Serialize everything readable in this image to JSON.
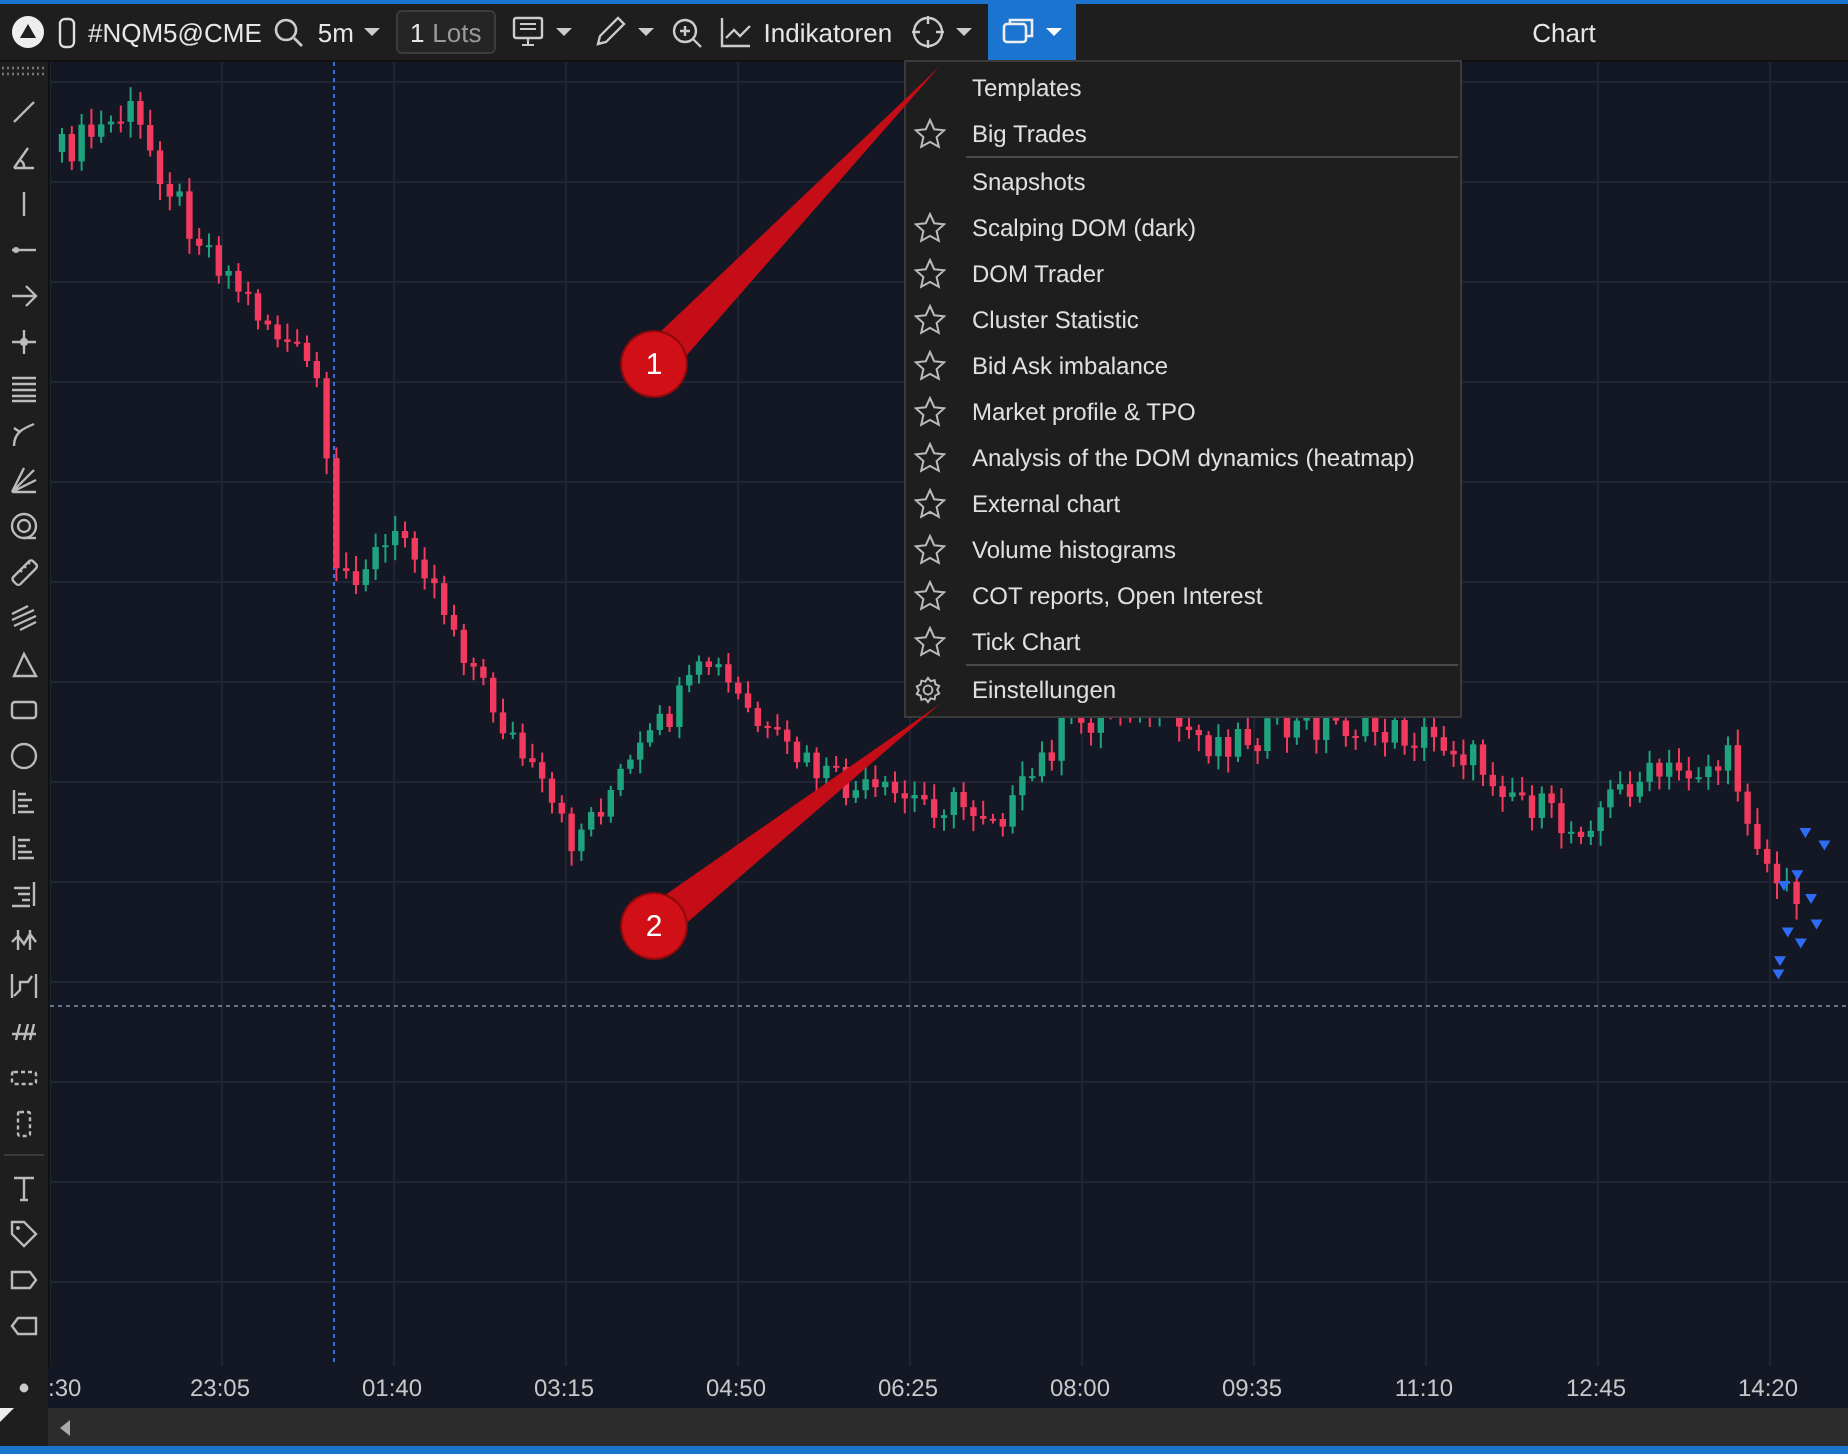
{
  "toolbar": {
    "symbol": "#NQM5@CME",
    "timeframe": "5m",
    "lots": {
      "value": "1",
      "unit": "Lots"
    },
    "indicators": "Indikatoren",
    "layouts_open": true
  },
  "window": {
    "title": "Chart"
  },
  "menu": {
    "items": [
      {
        "kind": "header",
        "label": "Templates"
      },
      {
        "kind": "favorite",
        "label": "Big Trades"
      },
      {
        "kind": "separator"
      },
      {
        "kind": "header",
        "label": "Snapshots"
      },
      {
        "kind": "favorite",
        "label": "Scalping DOM (dark)"
      },
      {
        "kind": "favorite",
        "label": "DOM Trader"
      },
      {
        "kind": "favorite",
        "label": "Cluster Statistic"
      },
      {
        "kind": "favorite",
        "label": "Bid Ask imbalance"
      },
      {
        "kind": "favorite",
        "label": "Market profile & TPO"
      },
      {
        "kind": "favorite",
        "label": "Analysis of the DOM dynamics (heatmap)"
      },
      {
        "kind": "favorite",
        "label": "External chart"
      },
      {
        "kind": "favorite",
        "label": "Volume histograms"
      },
      {
        "kind": "favorite",
        "label": "COT reports, Open Interest"
      },
      {
        "kind": "favorite",
        "label": "Tick Chart"
      },
      {
        "kind": "separator"
      },
      {
        "kind": "settings",
        "label": "Einstellungen"
      }
    ]
  },
  "time_axis": {
    "labels": [
      ":30",
      "23:05",
      "01:40",
      "03:15",
      "04:50",
      "06:25",
      "08:00",
      "09:35",
      "11:10",
      "12:45",
      "14:20"
    ]
  },
  "callouts": [
    {
      "label": "1"
    },
    {
      "label": "2"
    }
  ]
}
